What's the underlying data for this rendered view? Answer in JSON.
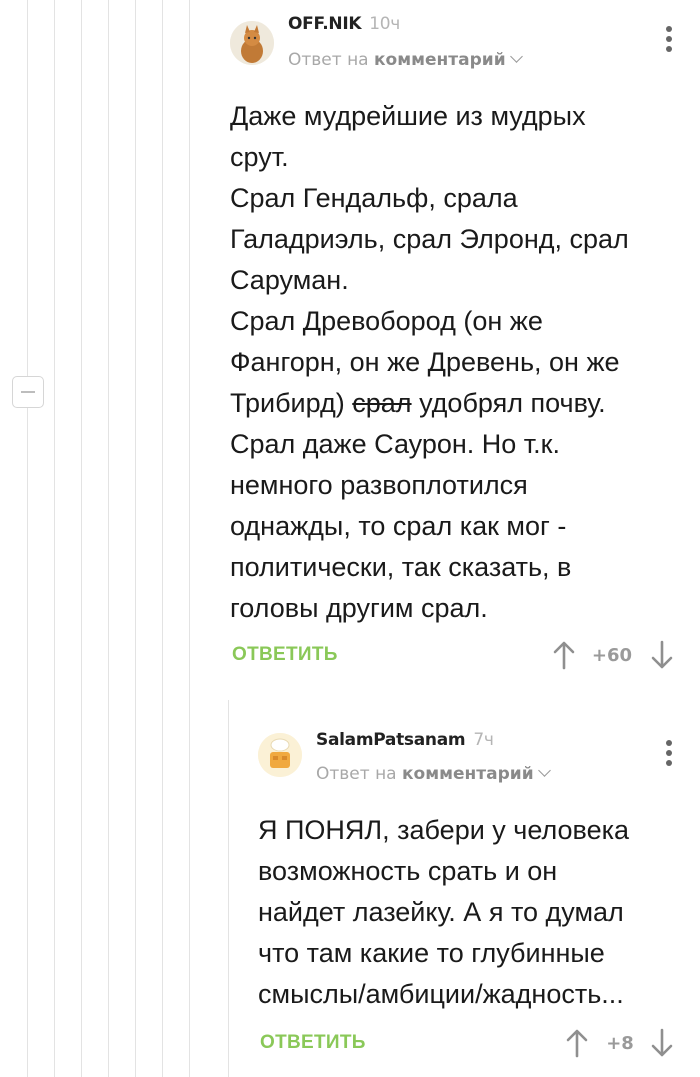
{
  "comments": [
    {
      "author": "OFF.NIK",
      "time": "10ч",
      "reply_prefix": "Ответ на",
      "reply_target": "комментарий",
      "body": {
        "line1": "Даже мудрейшие из мудрых",
        "line2": "срут.",
        "line3": "Срал Гендальф, срала",
        "line4": "Галадриэль, срал Элронд, срал",
        "line5": "Саруман.",
        "line6": "Срал Древобород (он же",
        "line7": "Фангорн, он же Древень, он же",
        "line8_before": "Трибирд) ",
        "line8_strike": "срал",
        "line8_after": " удобрял почву.",
        "line9": "Срал даже Саурон. Но т.к.",
        "line10": "немного развоплотился",
        "line11": "однажды, то срал как мог -",
        "line12": "политически, так сказать, в",
        "line13": "головы другим срал."
      },
      "reply_label": "ОТВЕТИТЬ",
      "rating": "+60"
    },
    {
      "author": "SalamPatsanam",
      "time": "7ч",
      "reply_prefix": "Ответ на",
      "reply_target": "комментарий",
      "body": {
        "line1": "Я ПОНЯЛ, забери у человека",
        "line2": "возможность срать и он",
        "line3": "найдет лазейку. А я то думал",
        "line4": "что там какие то глубинные",
        "line5": "смыслы/амбиции/жадность..."
      },
      "reply_label": "ОТВЕТИТЬ",
      "rating": "+8"
    }
  ],
  "icons": {
    "collapse": "minus-square-icon",
    "more": "vertical-dots-icon",
    "up": "arrow-up-icon",
    "down": "arrow-down-icon",
    "chevron": "chevron-down-icon"
  },
  "colors": {
    "reply_green": "#8ac858",
    "muted": "#a8a8a8",
    "thread_line": "#e3e3e3"
  }
}
